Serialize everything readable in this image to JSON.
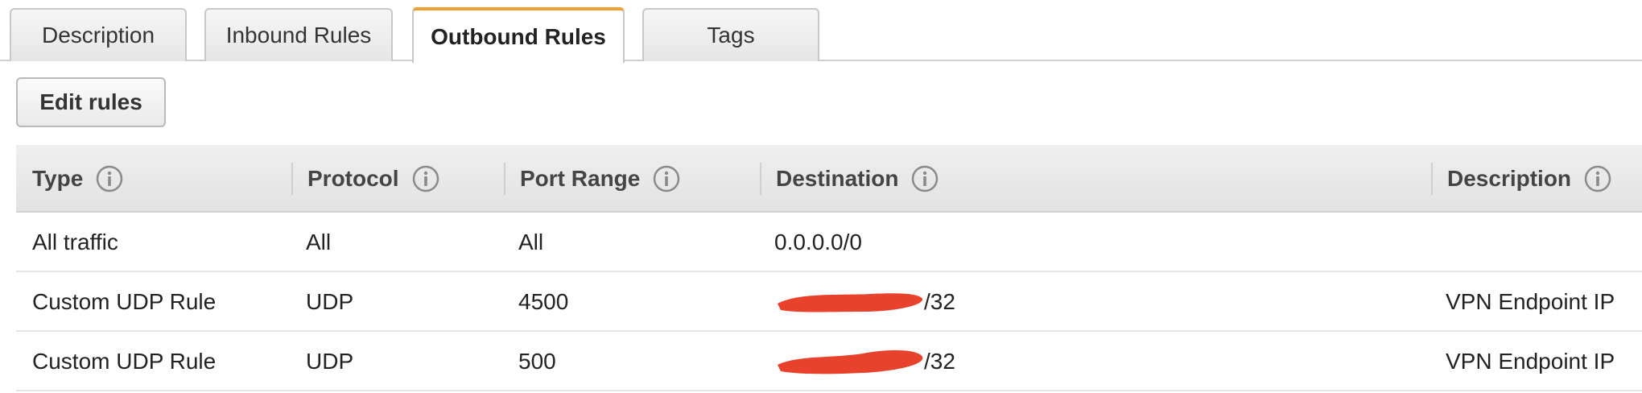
{
  "tabs": [
    {
      "label": "Description",
      "active": false
    },
    {
      "label": "Inbound Rules",
      "active": false
    },
    {
      "label": "Outbound Rules",
      "active": true
    },
    {
      "label": "Tags",
      "active": false
    }
  ],
  "toolbar": {
    "edit_rules_label": "Edit rules"
  },
  "table": {
    "columns": [
      "Type",
      "Protocol",
      "Port Range",
      "Destination",
      "Description"
    ],
    "rows": [
      {
        "type": "All traffic",
        "protocol": "All",
        "port_range": "All",
        "destination": "0.0.0.0/0",
        "destination_redacted": false,
        "description": ""
      },
      {
        "type": "Custom UDP Rule",
        "protocol": "UDP",
        "port_range": "4500",
        "destination": "/32",
        "destination_redacted": true,
        "description": "VPN Endpoint IP"
      },
      {
        "type": "Custom UDP Rule",
        "protocol": "UDP",
        "port_range": "500",
        "destination": "/32",
        "destination_redacted": true,
        "description": "VPN Endpoint IP"
      }
    ]
  },
  "colors": {
    "active_tab_accent": "#f0a030",
    "redaction": "#e8412c"
  },
  "icons": {
    "column_info": "info-circle-icon"
  }
}
